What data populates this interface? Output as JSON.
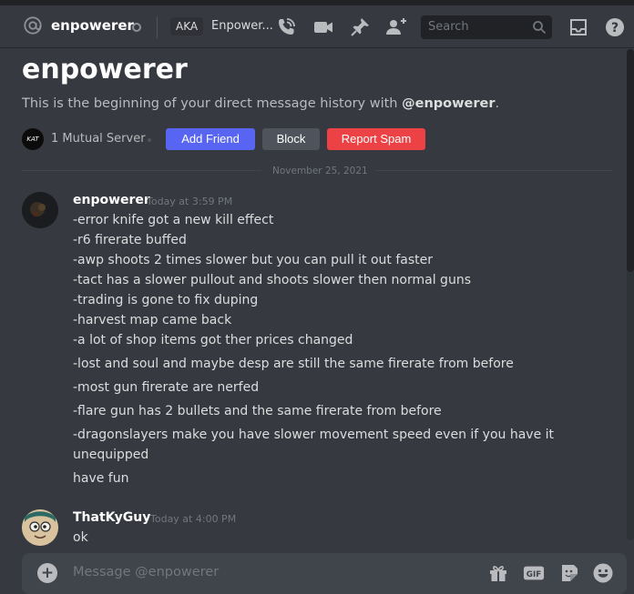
{
  "header": {
    "name": "enpowerer",
    "aka_label": "AKA",
    "nickname": "Enpower...",
    "search_placeholder": "Search"
  },
  "welcome": {
    "title": "enpowerer",
    "intro_prefix": "This is the beginning of your direct message history with ",
    "intro_handle": "@enpowerer",
    "intro_suffix": ".",
    "mutual_avatar_text": "KAT",
    "mutual_servers": "1 Mutual Server",
    "add_friend": "Add Friend",
    "block": "Block",
    "report_spam": "Report Spam"
  },
  "date_divider": "November 25, 2021",
  "messages": [
    {
      "author": "enpowerer",
      "timestamp": "Today at 3:59 PM",
      "lines": [
        "-error knife got a new kill effect",
        "-r6 firerate buffed",
        "-awp shoots 2 times slower but you can pull it out faster",
        "-tact has a slower pullout and shoots slower then normal guns",
        "-trading is gone to fix duping",
        "-harvest map came back",
        "-a lot of shop items got ther prices changed",
        "-lost and soul and maybe desp are still the same firerate from before",
        "-most gun firerate are nerfed",
        "-flare gun has 2 bullets and the same firerate from before",
        "-dragonslayers make you have slower movement speed even if you have it",
        "unequipped",
        "have fun"
      ]
    },
    {
      "author": "ThatKyGuy",
      "timestamp": "Today at 4:00 PM",
      "lines": [
        "ok"
      ]
    }
  ],
  "composer": {
    "placeholder": "Message @enpowerer",
    "gif_label": "GIF"
  },
  "colors": {
    "blurple": "#5865f2",
    "red": "#ed4245",
    "background": "#36393f"
  },
  "icons": [
    "at-icon",
    "status-icon",
    "call-icon",
    "video-icon",
    "pin-icon",
    "add-friend-icon",
    "search-icon",
    "inbox-icon",
    "help-icon",
    "plus-icon",
    "gift-icon",
    "gif-icon",
    "sticker-icon",
    "emoji-icon"
  ]
}
